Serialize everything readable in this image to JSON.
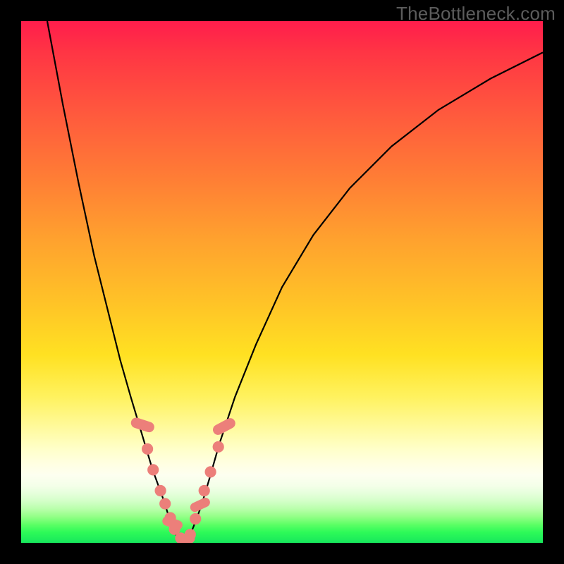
{
  "watermark": "TheBottleneck.com",
  "colors": {
    "frame": "#000000",
    "curve": "#000000",
    "marker": "#ec7f7a",
    "gradient_top": "#ff1d4c",
    "gradient_bottom": "#17e75c"
  },
  "chart_data": {
    "type": "line",
    "title": "",
    "xlabel": "",
    "ylabel": "",
    "xlim": [
      0,
      100
    ],
    "ylim": [
      0,
      100
    ],
    "axes_visible": false,
    "grid": false,
    "note": "Two black curves forming a V; y≈100 means maximum bottleneck (red), y≈0 means no bottleneck (green). Values estimated from pixel positions.",
    "series": [
      {
        "name": "left-curve",
        "x": [
          5,
          8,
          11,
          14,
          17,
          19,
          21,
          22.5,
          24,
          25.2,
          26.3,
          27.2,
          28,
          28.7,
          29.4,
          30
        ],
        "y": [
          100,
          84,
          69,
          55,
          43,
          35,
          28,
          23,
          18,
          14,
          11,
          8.5,
          6,
          4,
          2.2,
          0.8
        ]
      },
      {
        "name": "right-curve",
        "x": [
          32,
          33,
          34.5,
          36,
          38,
          41,
          45,
          50,
          56,
          63,
          71,
          80,
          90,
          100
        ],
        "y": [
          0.8,
          3,
          7,
          12,
          19,
          28,
          38,
          49,
          59,
          68,
          76,
          83,
          89,
          94
        ]
      }
    ],
    "markers": {
      "description": "Salmon dots and rounded pills along the lower part of both curves.",
      "circles": [
        {
          "x": 24.2,
          "y": 18.0,
          "r": 1.1
        },
        {
          "x": 25.3,
          "y": 14.0,
          "r": 1.1
        },
        {
          "x": 26.7,
          "y": 10.0,
          "r": 1.1
        },
        {
          "x": 27.6,
          "y": 7.5,
          "r": 1.1
        },
        {
          "x": 28.6,
          "y": 4.8,
          "r": 1.1
        },
        {
          "x": 29.4,
          "y": 2.6,
          "r": 1.1
        },
        {
          "x": 30.6,
          "y": 0.9,
          "r": 1.1
        },
        {
          "x": 32.4,
          "y": 1.6,
          "r": 1.1
        },
        {
          "x": 33.4,
          "y": 4.6,
          "r": 1.1
        },
        {
          "x": 35.1,
          "y": 10.0,
          "r": 1.1
        },
        {
          "x": 36.3,
          "y": 13.6,
          "r": 1.1
        },
        {
          "x": 37.8,
          "y": 18.4,
          "r": 1.1
        }
      ],
      "pills": [
        {
          "x": 23.3,
          "y": 22.6,
          "w": 2.0,
          "h": 4.6,
          "angle": -72
        },
        {
          "x": 29.0,
          "y": 3.8,
          "w": 1.8,
          "h": 4.0,
          "angle": -70
        },
        {
          "x": 31.5,
          "y": 0.8,
          "w": 3.6,
          "h": 1.8,
          "angle": 0
        },
        {
          "x": 34.3,
          "y": 7.3,
          "w": 1.8,
          "h": 4.0,
          "angle": 65
        },
        {
          "x": 38.9,
          "y": 22.3,
          "w": 2.0,
          "h": 4.6,
          "angle": 62
        }
      ]
    }
  }
}
